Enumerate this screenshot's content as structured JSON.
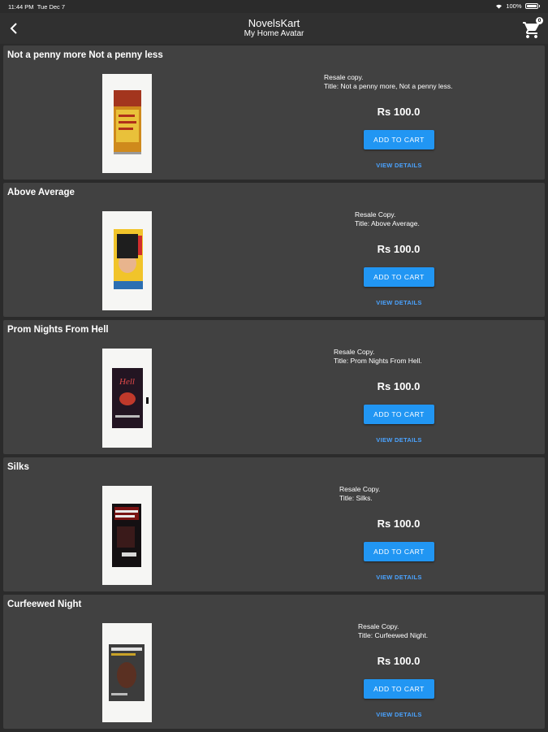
{
  "status_bar": {
    "time": "11:44 PM",
    "date": "Tue Dec 7",
    "battery": "100%"
  },
  "app_bar": {
    "title": "NovelsKart",
    "subtitle": "My Home Avatar",
    "cart_count": "0"
  },
  "books": [
    {
      "title": "Not a penny more Not a penny less",
      "desc1": "Resale copy.",
      "desc2": "Title: Not a penny more, Not a penny less.",
      "price": "Rs 100.0",
      "add_label": "ADD TO CART",
      "view_label": "VIEW DETAILS",
      "cover_color": "#d4a020"
    },
    {
      "title": "Above Average",
      "desc1": "Resale Copy.",
      "desc2": "Title: Above Average.",
      "price": "Rs 100.0",
      "add_label": "ADD TO CART",
      "view_label": "VIEW DETAILS",
      "cover_color": "#e6b51f"
    },
    {
      "title": "Prom Nights From Hell",
      "desc1": "Resale Copy.",
      "desc2": "Title: Prom Nights From Hell.",
      "price": "Rs 100.0",
      "add_label": "ADD TO CART",
      "view_label": "VIEW DETAILS",
      "cover_color": "#2a1a2e"
    },
    {
      "title": "Silks",
      "desc1": "Resale Copy.",
      "desc2": "Title: Silks.",
      "price": "Rs 100.0",
      "add_label": "ADD TO CART",
      "view_label": "VIEW DETAILS",
      "cover_color": "#1a1416"
    },
    {
      "title": "Curfeewed Night",
      "desc1": "Resale Copy.",
      "desc2": "Title: Curfeewed Night.",
      "price": "Rs 100.0",
      "add_label": "ADD TO CART",
      "view_label": "VIEW DETAILS",
      "cover_color": "#3a3a3a"
    }
  ]
}
